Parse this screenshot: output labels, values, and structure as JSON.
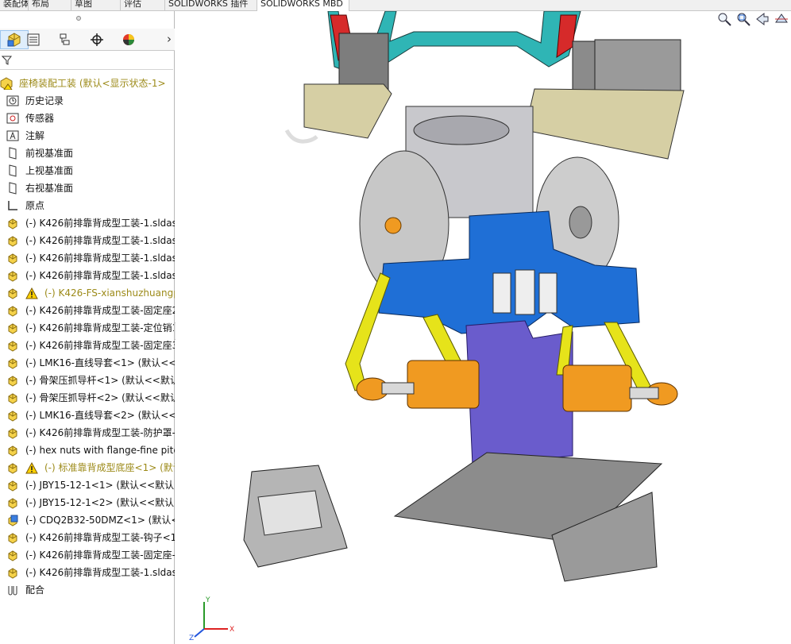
{
  "command_tabs": [
    {
      "label": "装配体",
      "active": false
    },
    {
      "label": "布局",
      "active": false
    },
    {
      "label": "草图",
      "active": false
    },
    {
      "label": "评估",
      "active": false
    },
    {
      "label": "SOLIDWORKS 插件",
      "active": false
    },
    {
      "label": "SOLIDWORKS MBD",
      "active": true
    }
  ],
  "panel_tabs": [
    "feature-manager",
    "property-manager",
    "configuration-manager",
    "dimxpert-manager",
    "display-manager"
  ],
  "tree": {
    "root": {
      "label": "座椅装配工装  (默认<显示状态-1>",
      "icon": "assembly-warning-icon"
    },
    "items": [
      {
        "label": "历史记录",
        "icon": "history-icon"
      },
      {
        "label": "传感器",
        "icon": "sensor-icon"
      },
      {
        "label": "注解",
        "icon": "annotation-icon"
      },
      {
        "label": "前视基准面",
        "icon": "plane-icon"
      },
      {
        "label": "上视基准面",
        "icon": "plane-icon"
      },
      {
        "label": "右视基准面",
        "icon": "plane-icon"
      },
      {
        "label": "原点",
        "icon": "origin-icon"
      },
      {
        "label": "(-) K426前排靠背成型工装-1.sldas",
        "icon": "subassembly-icon",
        "warn": false
      },
      {
        "label": "(-) K426前排靠背成型工装-1.sldas",
        "icon": "subassembly-icon",
        "warn": false
      },
      {
        "label": "(-) K426前排靠背成型工装-1.sldas",
        "icon": "subassembly-icon",
        "warn": false
      },
      {
        "label": "(-) K426前排靠背成型工装-1.sldas",
        "icon": "subassembly-icon",
        "warn": false
      },
      {
        "label": "(-) K426-FS-xianshuzhuangp",
        "icon": "subassembly-icon",
        "warn": true
      },
      {
        "label": "(-) K426前排靠背成型工装-固定座2",
        "icon": "subassembly-icon",
        "warn": false
      },
      {
        "label": "(-) K426前排靠背成型工装-定位销1",
        "icon": "subassembly-icon",
        "warn": false
      },
      {
        "label": "(-) K426前排靠背成型工装-固定座3",
        "icon": "subassembly-icon",
        "warn": false
      },
      {
        "label": "(-) LMK16-直线导套<1> (默认<<默",
        "icon": "subassembly-icon",
        "warn": false
      },
      {
        "label": "(-) 骨架压抓导杆<1> (默认<<默认",
        "icon": "subassembly-icon",
        "warn": false
      },
      {
        "label": "(-) 骨架压抓导杆<2> (默认<<默认",
        "icon": "subassembly-icon",
        "warn": false
      },
      {
        "label": "(-) LMK16-直线导套<2> (默认<<默",
        "icon": "subassembly-icon",
        "warn": false
      },
      {
        "label": "(-) K426前排靠背成型工装-防护罩-",
        "icon": "subassembly-icon",
        "warn": false
      },
      {
        "label": "(-) hex nuts with flange-fine pitch",
        "icon": "subassembly-icon",
        "warn": false
      },
      {
        "label": "(-) 标准靠背成型底座<1> (默认",
        "icon": "subassembly-icon",
        "warn": true
      },
      {
        "label": "(-) JBY15-12-1<1> (默认<<默认>",
        "icon": "subassembly-icon",
        "warn": false
      },
      {
        "label": "(-) JBY15-12-1<2> (默认<<默认>",
        "icon": "subassembly-icon",
        "warn": false
      },
      {
        "label": "(-) CDQ2B32-50DMZ<1> (默认<",
        "icon": "part-icon",
        "warn": false
      },
      {
        "label": "(-) K426前排靠背成型工装-钩子<1",
        "icon": "subassembly-icon",
        "warn": false
      },
      {
        "label": "(-) K426前排靠背成型工装-固定座-",
        "icon": "subassembly-icon",
        "warn": false
      },
      {
        "label": "(-) K426前排靠背成型工装-1.sldas",
        "icon": "subassembly-icon",
        "warn": false
      },
      {
        "label": "配合",
        "icon": "mates-icon"
      }
    ]
  },
  "colors": {
    "warn_text": "#9c8a18",
    "blue_frame": "#1f6fd6",
    "yellow_arm": "#e6e31a",
    "cylinder_orange": "#f09a21",
    "purple_column": "#6a5ccc",
    "teal_top": "#2fb5b5"
  },
  "heads_up_icons": [
    "zoom-fit-icon",
    "zoom-area-icon",
    "previous-view-icon",
    "section-view-icon"
  ],
  "triad": {
    "x": "X",
    "y": "Y",
    "z": "Z"
  }
}
